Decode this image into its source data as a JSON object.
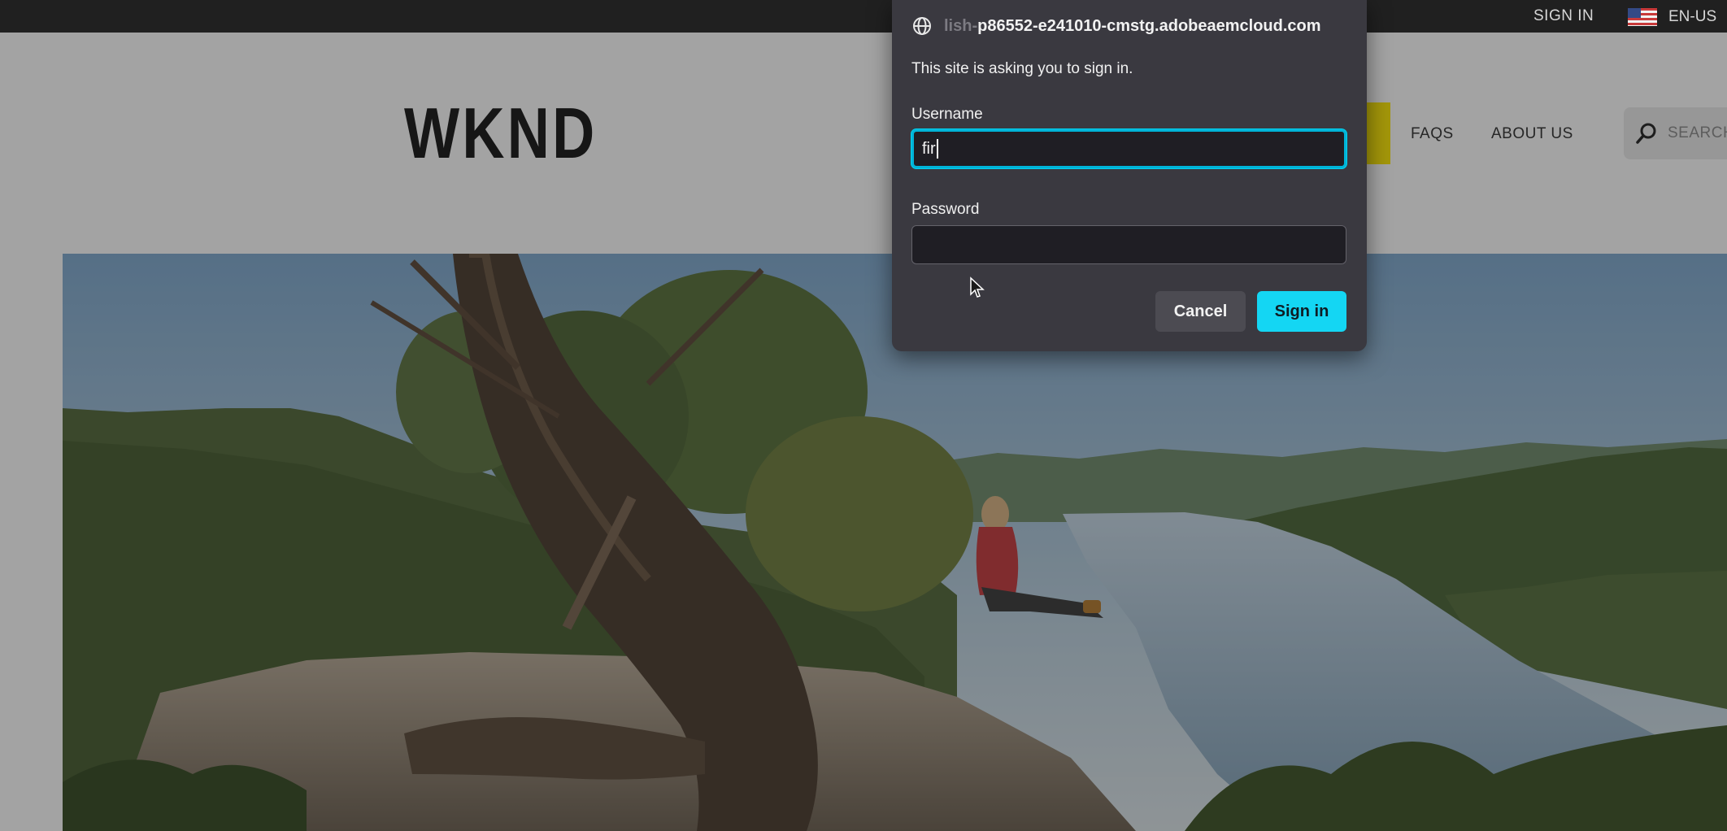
{
  "top_bar": {
    "sign_in": "SIGN IN",
    "language": "EN-US",
    "flag_icon": "us-flag-icon"
  },
  "header": {
    "logo": "WKND",
    "nav": [
      {
        "label": "FAQS"
      },
      {
        "label": "ABOUT US"
      }
    ],
    "search_placeholder": "SEARCH",
    "search_icon": "search-icon",
    "accent_color": "#ffea00"
  },
  "hero": {
    "scene": "hiker-overlooking-river-valley"
  },
  "auth_dialog": {
    "origin_hidden_prefix": "lish-",
    "origin": "p86552-e241010-cmstg.adobeaemcloud.com",
    "origin_icon": "globe-icon",
    "message": "This site is asking you to sign in.",
    "username_label": "Username",
    "username_value": "fir",
    "password_label": "Password",
    "password_value": "",
    "cancel_label": "Cancel",
    "signin_label": "Sign in",
    "focus_color": "#00b4d8",
    "primary_color": "#14d6f3"
  }
}
